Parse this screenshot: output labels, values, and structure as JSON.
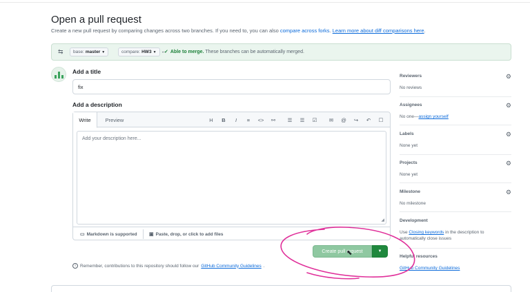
{
  "header": {
    "title": "Open a pull request",
    "subtitle_prefix": "Create a new pull request by comparing changes across two branches. If you need to, you can also ",
    "compare_forks_link": "compare across forks",
    "subtitle_mid": ". ",
    "learn_more_link": "Learn more about diff comparisons here",
    "subtitle_end": "."
  },
  "compare": {
    "base_prefix": "base:",
    "base_value": "master",
    "compare_prefix": "compare:",
    "compare_value": "HW3",
    "merge_status": "Able to merge.",
    "merge_detail": "These branches can be automatically merged."
  },
  "form": {
    "title_label": "Add a title",
    "title_value": "fix",
    "description_label": "Add a description",
    "tabs": [
      "Write",
      "Preview"
    ],
    "toolbar_icons": [
      "H",
      "B",
      "I",
      "≡",
      "<>",
      "⚯",
      "☰",
      "☰",
      "☑",
      "✉",
      "@",
      "↪",
      "↶",
      "☐"
    ],
    "description_placeholder": "Add your description here...",
    "markdown_label": "Markdown is supported",
    "attach_label": "Paste, drop, or click to add files",
    "create_button": "Create pull request",
    "remember_text": "Remember, contributions to this repository should follow our ",
    "guidelines_link": "GitHub Community Guidelines",
    "remember_end": "."
  },
  "sidebar": {
    "reviewers": {
      "label": "Reviewers",
      "value": "No reviews"
    },
    "assignees": {
      "label": "Assignees",
      "value_prefix": "No one—",
      "link": "assign yourself"
    },
    "labels": {
      "label": "Labels",
      "value": "None yet"
    },
    "projects": {
      "label": "Projects",
      "value": "None yet"
    },
    "milestone": {
      "label": "Milestone",
      "value": "No milestone"
    },
    "development": {
      "label": "Development",
      "value_prefix": "Use ",
      "link": "Closing keywords",
      "value_suffix": " in the description to automatically close issues"
    },
    "helpful": {
      "label": "Helpful resources",
      "link": "GitHub Community Guidelines"
    }
  },
  "colors": {
    "merge_green": "#1a7f37",
    "link_blue": "#0969da",
    "annotation_pink": "#e0309a"
  }
}
